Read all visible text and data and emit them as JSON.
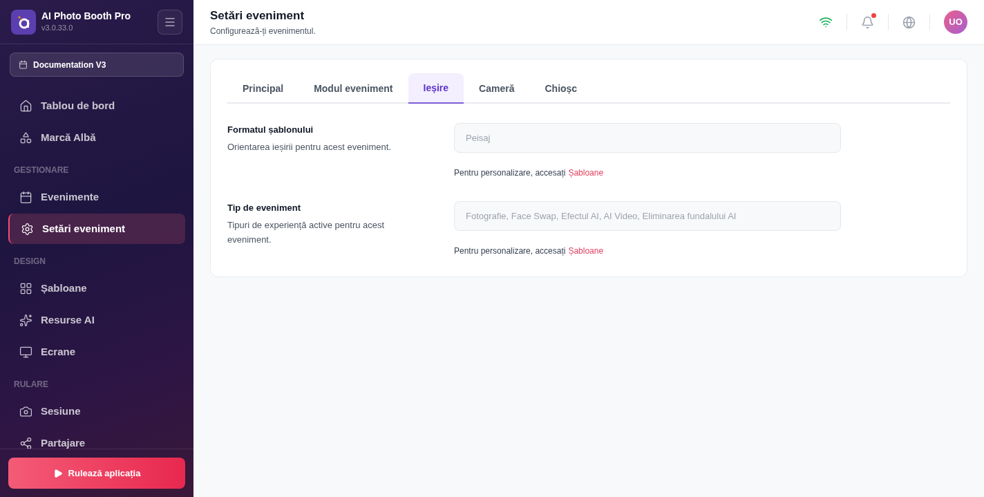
{
  "app": {
    "name": "AI Photo Booth Pro",
    "version": "v3.0.33.0"
  },
  "event_selector": {
    "label": "Documentation V3"
  },
  "sidebar": {
    "sections": [
      {
        "items": [
          {
            "label": "Tablou de bord",
            "selected": false
          },
          {
            "label": "Marcă Albă",
            "selected": false
          }
        ]
      },
      {
        "title": "GESTIONARE",
        "items": [
          {
            "label": "Evenimente",
            "selected": false
          },
          {
            "label": "Setări eveniment",
            "selected": true
          }
        ]
      },
      {
        "title": "DESIGN",
        "items": [
          {
            "label": "Șabloane",
            "selected": false
          },
          {
            "label": "Resurse AI",
            "selected": false
          },
          {
            "label": "Ecrane",
            "selected": false
          }
        ]
      },
      {
        "title": "RULARE",
        "items": [
          {
            "label": "Sesiune",
            "selected": false
          },
          {
            "label": "Partajare",
            "selected": false
          }
        ]
      }
    ]
  },
  "run_button": {
    "label": "Rulează aplicația"
  },
  "header": {
    "title": "Setări eveniment",
    "subtitle": "Configurează-ți evenimentul.",
    "notification_dot": true,
    "avatar": "UO"
  },
  "tabs": [
    {
      "label": "Principal",
      "selected": false
    },
    {
      "label": "Modul eveniment",
      "selected": false
    },
    {
      "label": "Ieșire",
      "selected": true
    },
    {
      "label": "Cameră",
      "selected": false
    },
    {
      "label": "Chioșc",
      "selected": false
    }
  ],
  "settings": [
    {
      "title": "Formatul șablonului",
      "description": "Orientarea ieșirii pentru acest eveniment.",
      "value": "Peisaj",
      "disabled": true,
      "hint": "Pentru personalizare, accesați",
      "link": "Șabloane"
    },
    {
      "title": "Tip de eveniment",
      "description": "Tipuri de experiență active pentru acest eveniment.",
      "value": "Fotografie, Face Swap, Efectul AI, AI Video, Eliminarea fundalului AI",
      "disabled": true,
      "hint": "Pentru personalizare, accesați",
      "link": "Șabloane"
    }
  ]
}
